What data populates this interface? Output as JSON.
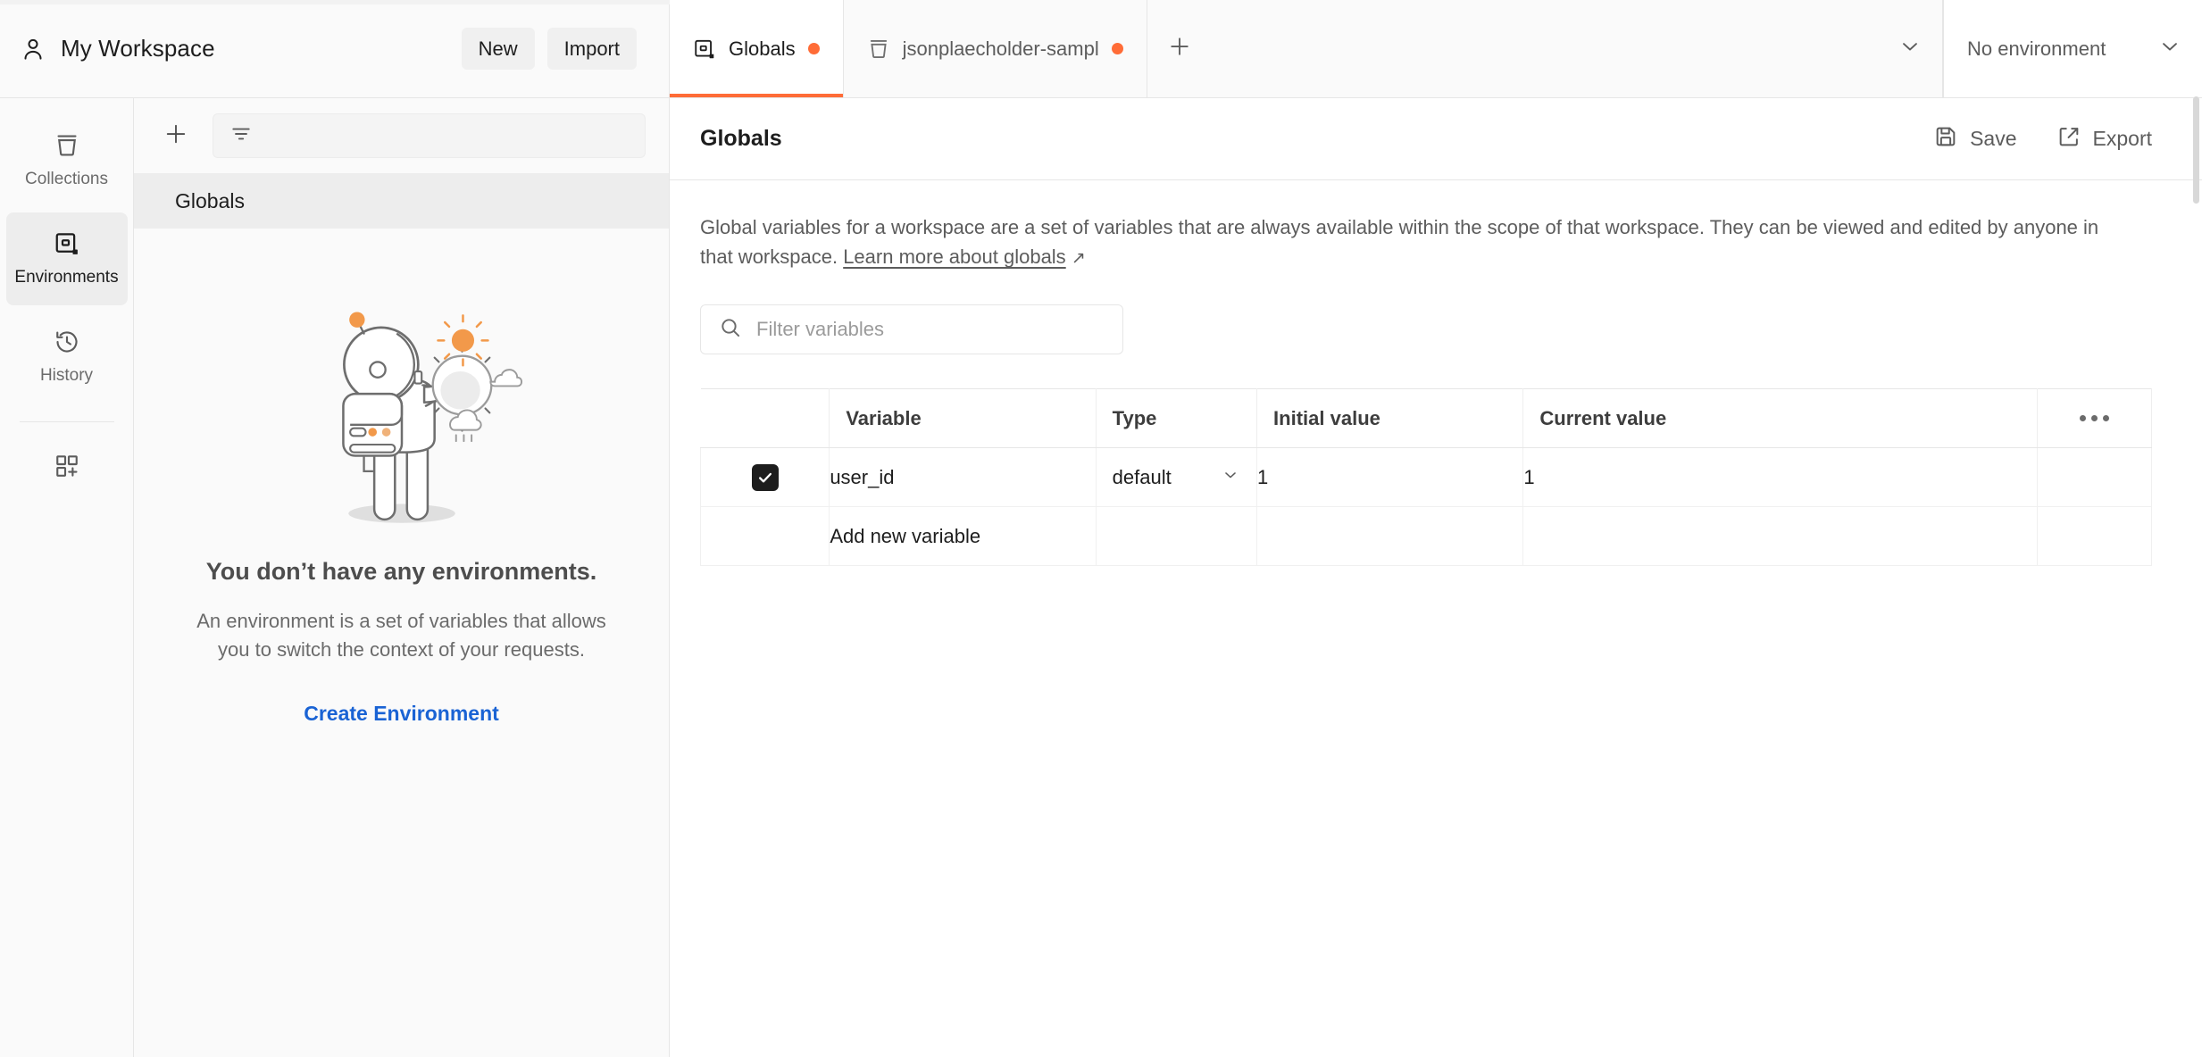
{
  "workspace": {
    "icon": "person-icon",
    "title": "My Workspace",
    "new_label": "New",
    "import_label": "Import"
  },
  "tabs": [
    {
      "label": "Globals",
      "icon": "environment-icon",
      "active": true,
      "unsaved": true
    },
    {
      "label": "jsonplaecholder-sampl",
      "icon": "collection-icon",
      "active": false,
      "unsaved": true
    }
  ],
  "tabbar": {
    "add_tab_icon": "plus-icon",
    "tabs_overflow_icon": "chevron-down-icon"
  },
  "environment_selector": {
    "label": "No environment",
    "icon": "chevron-down-icon"
  },
  "rail": {
    "items": [
      {
        "label": "Collections",
        "icon": "collection-icon",
        "active": false
      },
      {
        "label": "Environments",
        "icon": "environment-icon",
        "active": true
      },
      {
        "label": "History",
        "icon": "history-clock-icon",
        "active": false
      }
    ],
    "apps_item": {
      "icon": "grid-plus-icon"
    }
  },
  "list_panel": {
    "add_icon": "plus-icon",
    "filter_icon": "filter-lines-icon",
    "filter_placeholder": "",
    "environments": [
      {
        "label": "Globals",
        "selected": true
      }
    ],
    "empty_state": {
      "illustration": "astronaut-illustration",
      "title": "You don’t have any environments.",
      "description": "An environment is a set of variables that allows you to switch the context of your requests.",
      "cta_label": "Create Environment"
    }
  },
  "main": {
    "title": "Globals",
    "save_label": "Save",
    "save_icon": "save-floppy-icon",
    "export_label": "Export",
    "export_icon": "export-share-icon",
    "description_part1": "Global variables for a workspace are a set of variables that are always available within the scope of that workspace. They can be viewed and edited by anyone in that workspace. ",
    "description_link": "Learn more about globals",
    "description_link_arrow": "↗",
    "filter": {
      "icon": "search-icon",
      "placeholder": "Filter variables",
      "value": ""
    },
    "table": {
      "columns": [
        "Variable",
        "Type",
        "Initial value",
        "Current value"
      ],
      "menu_icon": "ellipsis-icon",
      "rows": [
        {
          "enabled": true,
          "variable": "user_id",
          "type": "default",
          "type_icon": "chevron-down-icon",
          "initial_value": "1",
          "current_value": "1"
        }
      ],
      "add_row_placeholder": "Add new variable"
    }
  },
  "colors": {
    "accent": "#ff6c37",
    "link": "#1a63d4",
    "text": "#1d1d1d",
    "muted": "#6b6b6b",
    "panel_bg": "#fafafa",
    "selected_bg": "#ededed"
  }
}
